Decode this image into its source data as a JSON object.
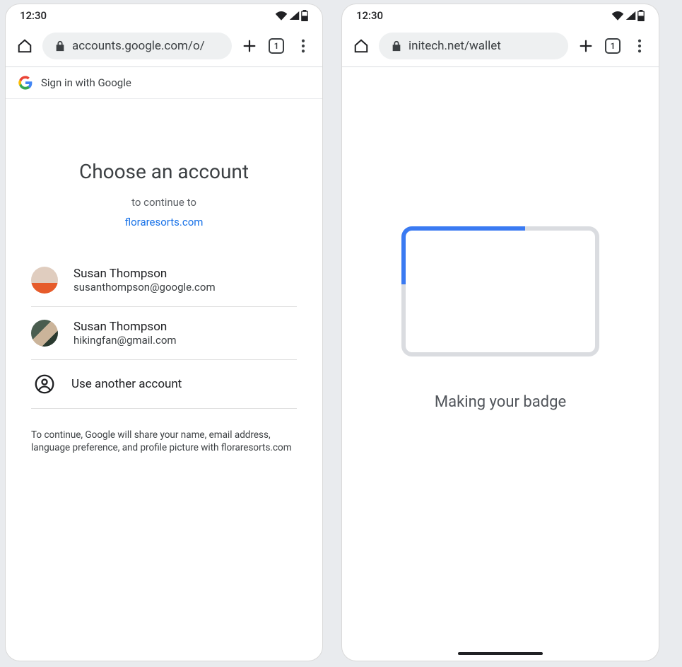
{
  "status_time": "12:30",
  "phone1": {
    "url": "accounts.google.com/o/",
    "tab_count": "1",
    "signin_header": "Sign in with Google",
    "title": "Choose an account",
    "subtitle": "to continue to",
    "site_link": "floraresorts.com",
    "accounts": [
      {
        "name": "Susan Thompson",
        "email": "susanthompson@google.com"
      },
      {
        "name": "Susan Thompson",
        "email": "hikingfan@gmail.com"
      }
    ],
    "use_another": "Use another account",
    "disclaimer": "To continue, Google will share your name, email address, language preference, and profile picture with floraresorts.com"
  },
  "phone2": {
    "url": "initech.net/wallet",
    "tab_count": "1",
    "making_label": "Making your badge"
  }
}
